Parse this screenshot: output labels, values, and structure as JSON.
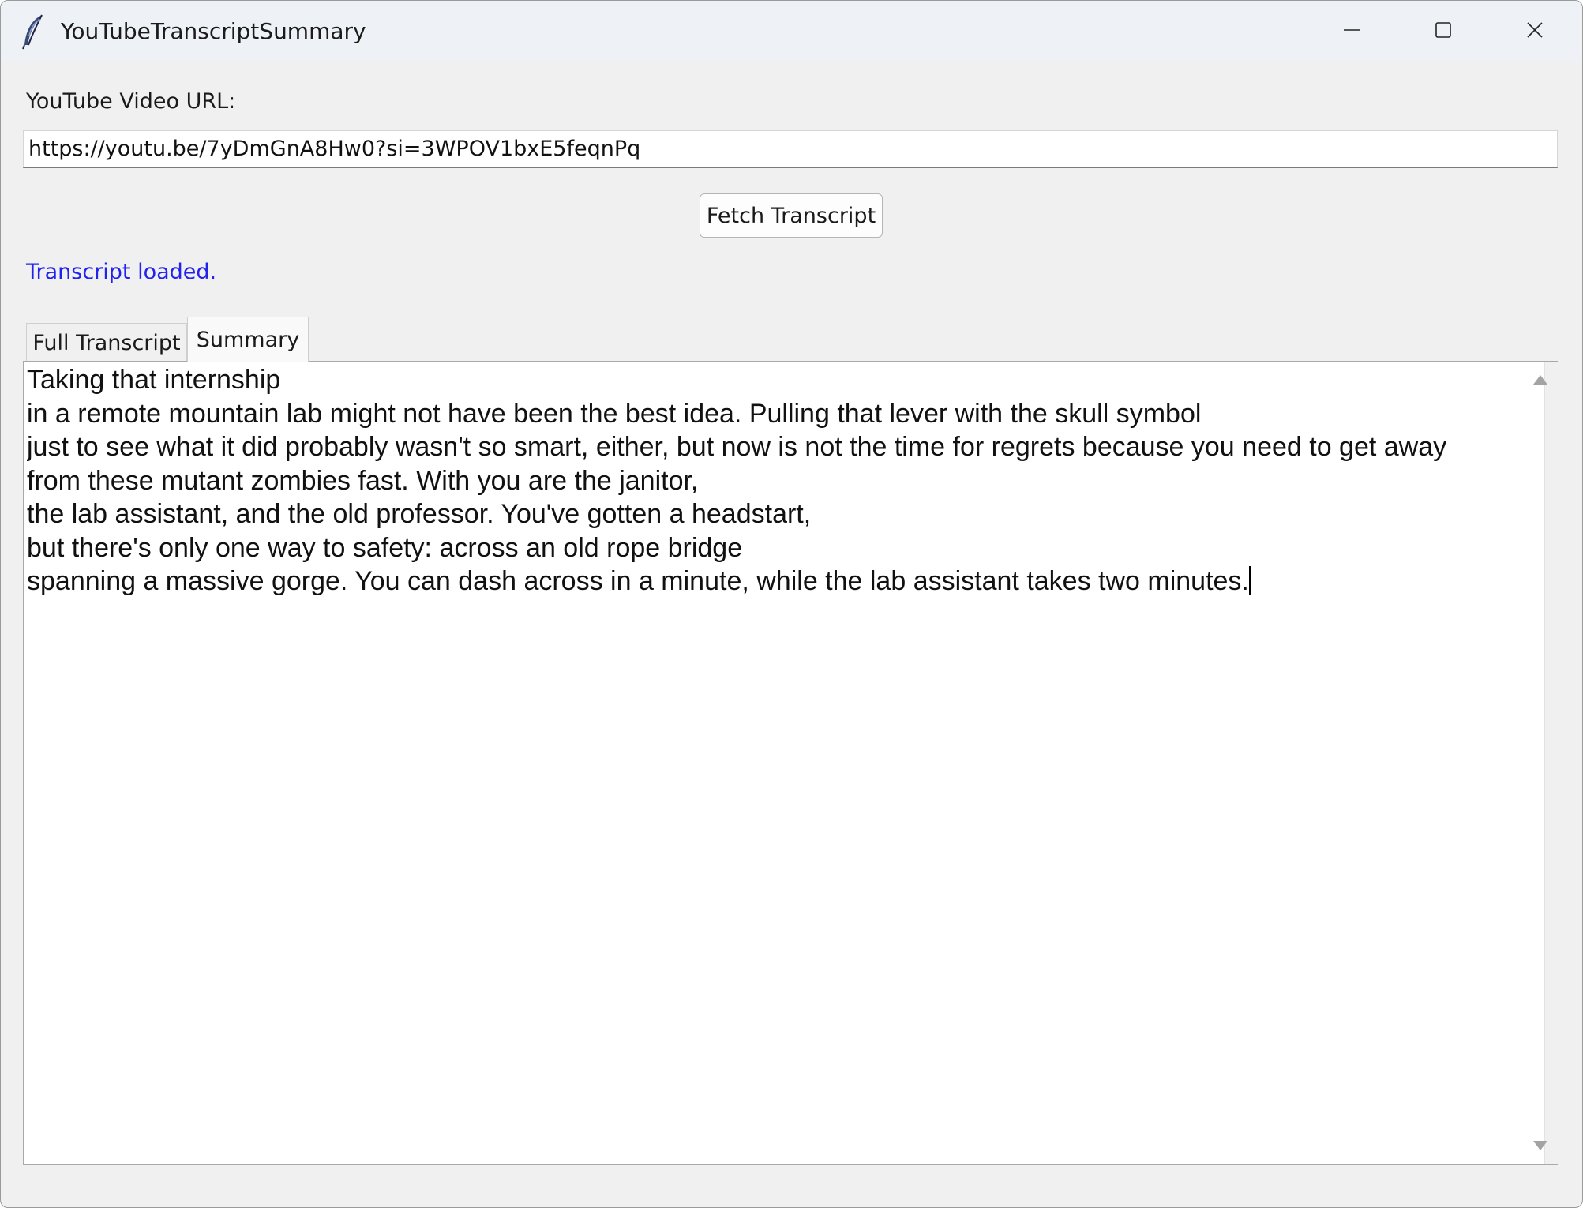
{
  "window": {
    "title": "YouTubeTranscriptSummary",
    "icon": "feather-icon",
    "controls": [
      "minimize-icon",
      "maximize-icon",
      "close-icon"
    ]
  },
  "form": {
    "url_label": "YouTube Video URL:",
    "url_value": "https://youtu.be/7yDmGnA8Hw0?si=3WPOV1bxE5feqnPq",
    "fetch_button": "Fetch Transcript",
    "status": "Transcript loaded.",
    "status_color": "#2222ee"
  },
  "tabs": [
    {
      "label": "Full Transcript",
      "selected": false
    },
    {
      "label": "Summary",
      "selected": true
    }
  ],
  "summary": {
    "lines": [
      "Taking that internship",
      "in a remote mountain lab might not have been the best idea. Pulling that lever with the skull symbol",
      "just to see what it did probably wasn't so smart, either, but now is not the time for regrets because you need to get away",
      "from these mutant zombies fast. With you are the janitor,",
      "the lab assistant, and the old professor. You've gotten a headstart,",
      "but there's only one way to safety: across an old rope bridge",
      "spanning a massive gorge. You can dash across in a minute, while the lab assistant takes two minutes."
    ]
  }
}
